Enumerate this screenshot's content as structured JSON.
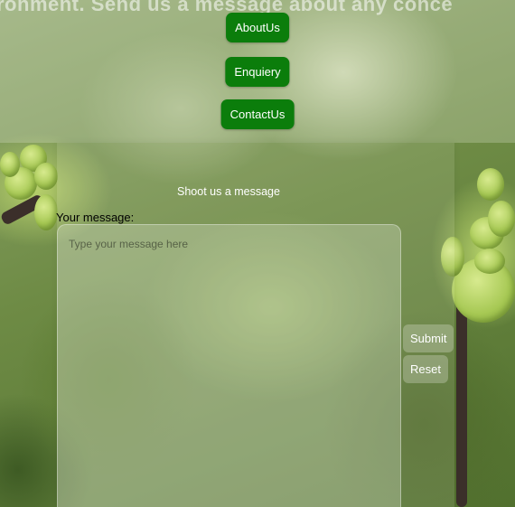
{
  "banner": {
    "scroll_text": "ronment. Send us a message about any conce"
  },
  "nav": {
    "items": [
      {
        "label": "AboutUs"
      },
      {
        "label": "Enquiery"
      },
      {
        "label": "ContactUs"
      }
    ]
  },
  "form": {
    "title": "Shoot us a message",
    "message_label": "Your message:",
    "message_placeholder": "Type your message here",
    "submit_label": "Submit",
    "reset_label": "Reset"
  },
  "colors": {
    "nav_button": "#0b7d0b",
    "text_light": "#ffffff"
  }
}
